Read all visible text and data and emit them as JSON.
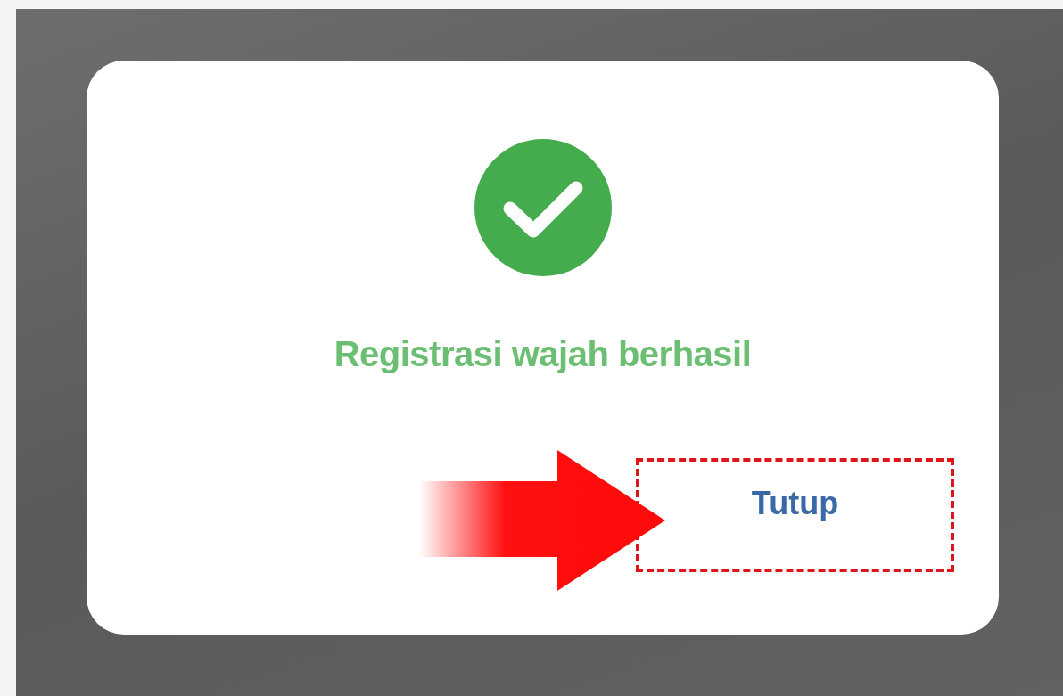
{
  "dialog": {
    "message": "Registrasi wajah berhasil",
    "buttons": [
      {
        "label": "Tutup",
        "highlighted": true
      }
    ]
  }
}
